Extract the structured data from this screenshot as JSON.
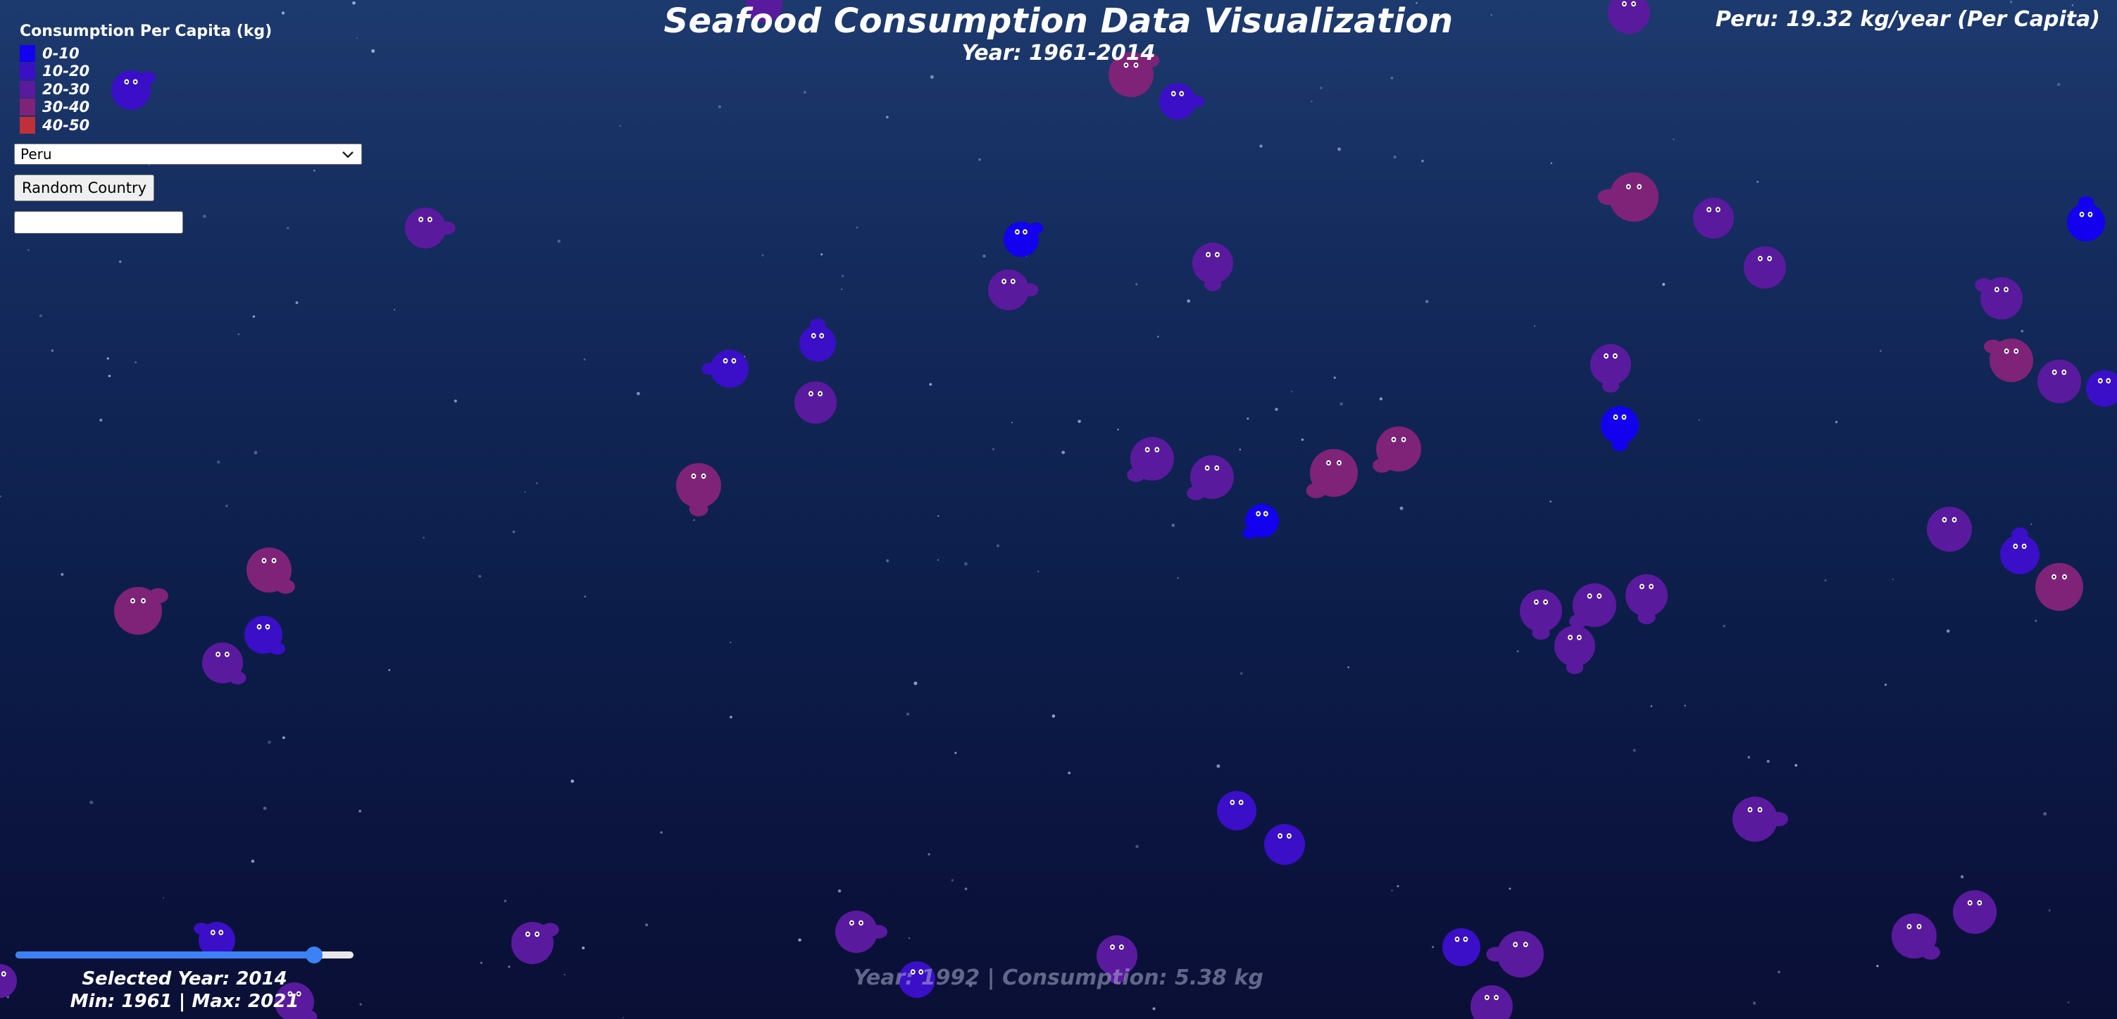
{
  "header": {
    "title": "Seafood Consumption Data Visualization",
    "subtitle": "Year: 1961-2014"
  },
  "country_readout": "Peru: 19.32 kg/year (Per Capita)",
  "legend": {
    "title": "Consumption Per Capita (kg)",
    "items": [
      {
        "label": "0-10",
        "color": "#1200ee"
      },
      {
        "label": "10-20",
        "color": "#3a0fc7"
      },
      {
        "label": "20-30",
        "color": "#5a1a9e"
      },
      {
        "label": "30-40",
        "color": "#7e2378"
      },
      {
        "label": "40-50",
        "color": "#c0303a"
      }
    ]
  },
  "controls": {
    "country_select": {
      "selected": "Peru"
    },
    "random_button_label": "Random Country",
    "text_input_value": ""
  },
  "year_slider": {
    "min": 1961,
    "max": 2021,
    "value": 2014,
    "selected_label": "Selected Year: 2014",
    "range_label": "Min: 1961 | Max: 2021",
    "accent": "#3b82f6"
  },
  "hover_readout": "Year: 1992 | Consumption: 5.38 kg"
}
